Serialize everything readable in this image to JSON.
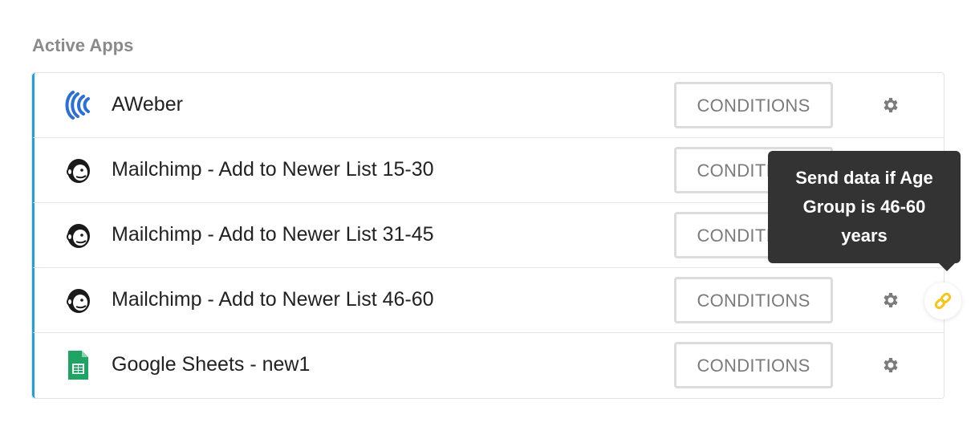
{
  "section": {
    "title": "Active Apps"
  },
  "apps": [
    {
      "name": "AWeber",
      "icon": "aweber-logo-icon",
      "conditions_label": "CONDITIONS",
      "settings_icon": "gear-icon"
    },
    {
      "name": "Mailchimp - Add to Newer List 15-30",
      "icon": "mailchimp-logo-icon",
      "conditions_label": "CONDITIONS",
      "settings_icon": "gear-icon"
    },
    {
      "name": "Mailchimp - Add to Newer List 31-45",
      "icon": "mailchimp-logo-icon",
      "conditions_label": "CONDITIONS",
      "settings_icon": "gear-icon"
    },
    {
      "name": "Mailchimp - Add to Newer List 46-60",
      "icon": "mailchimp-logo-icon",
      "conditions_label": "CONDITIONS",
      "settings_icon": "gear-icon"
    },
    {
      "name": "Google Sheets - new1",
      "icon": "google-sheets-logo-icon",
      "conditions_label": "CONDITIONS",
      "settings_icon": "gear-icon"
    }
  ],
  "tooltip": {
    "text": "Send data if Age Group is 46-60 years"
  },
  "link_icon": "link-icon",
  "colors": {
    "accent_bar": "#1ea1d8",
    "tooltip_bg": "#333333",
    "link_icon": "#f5c518",
    "aweber": "#2c6fd6",
    "sheets": "#1fa463"
  }
}
